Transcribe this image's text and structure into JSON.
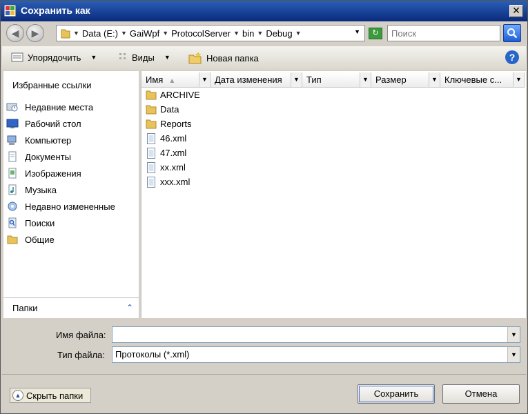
{
  "window": {
    "title": "Сохранить как",
    "close_glyph": "✕"
  },
  "address": {
    "breadcrumbs": [
      "Data (E:)",
      "GaiWpf",
      "ProtocolServer",
      "bin",
      "Debug"
    ]
  },
  "search": {
    "placeholder": "Поиск"
  },
  "toolbar": {
    "organize_label": "Упорядочить",
    "views_label": "Виды",
    "new_folder_label": "Новая папка",
    "help_glyph": "?"
  },
  "navigation": {
    "favorites_title": "Избранные ссылки",
    "items": [
      {
        "label": "Недавние места",
        "icon": "recent-places-icon"
      },
      {
        "label": "Рабочий стол",
        "icon": "desktop-icon"
      },
      {
        "label": "Компьютер",
        "icon": "computer-icon"
      },
      {
        "label": "Документы",
        "icon": "documents-icon"
      },
      {
        "label": "Изображения",
        "icon": "pictures-icon"
      },
      {
        "label": "Музыка",
        "icon": "music-icon"
      },
      {
        "label": "Недавно измененные",
        "icon": "recently-changed-icon"
      },
      {
        "label": "Поиски",
        "icon": "searches-icon"
      },
      {
        "label": "Общие",
        "icon": "public-folder-icon"
      }
    ],
    "folders_label": "Папки"
  },
  "file_list": {
    "columns": [
      "Имя",
      "Дата изменения",
      "Тип",
      "Размер",
      "Ключевые с..."
    ],
    "files": [
      {
        "name": "ARCHIVE",
        "kind": "folder"
      },
      {
        "name": "Data",
        "kind": "folder"
      },
      {
        "name": "Reports",
        "kind": "folder"
      },
      {
        "name": "46.xml",
        "kind": "file"
      },
      {
        "name": "47.xml",
        "kind": "file"
      },
      {
        "name": "xx.xml",
        "kind": "file"
      },
      {
        "name": "xxx.xml",
        "kind": "file"
      }
    ]
  },
  "form": {
    "filename_label": "Имя файла:",
    "filename_value": "",
    "filetype_label": "Тип файла:",
    "filetype_value": "Протоколы (*.xml)"
  },
  "buttons": {
    "hide_folders": "Скрыть папки",
    "save": "Сохранить",
    "cancel": "Отмена"
  },
  "colors": {
    "titlebar": "#0a2a7c",
    "folder": "#e8c35a",
    "accent": "#2766c8"
  }
}
